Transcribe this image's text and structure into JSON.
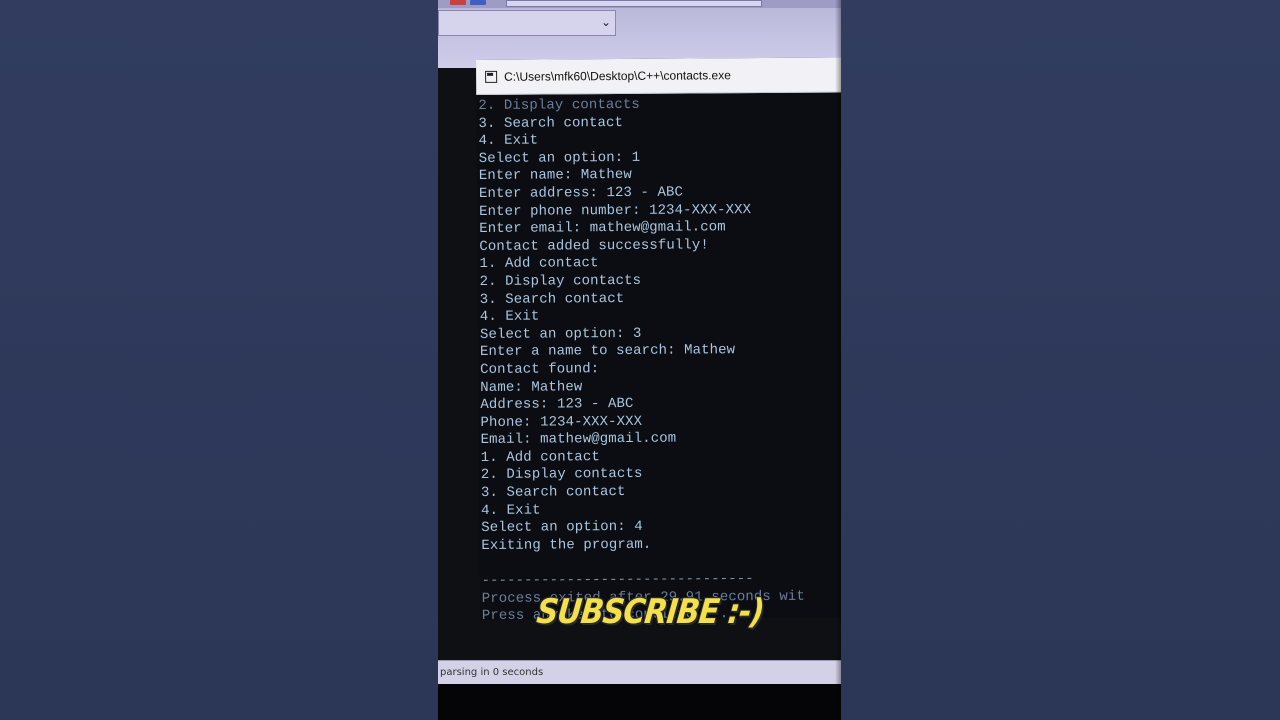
{
  "window": {
    "title": "C:\\Users\\mfk60\\Desktop\\C++\\contacts.exe"
  },
  "console_lines": [
    "2. Display contacts",
    "3. Search contact",
    "4. Exit",
    "Select an option: 1",
    "Enter name: Mathew",
    "Enter address: 123 - ABC",
    "Enter phone number: 1234-XXX-XXX",
    "Enter email: mathew@gmail.com",
    "Contact added successfully!",
    "1. Add contact",
    "2. Display contacts",
    "3. Search contact",
    "4. Exit",
    "Select an option: 3",
    "Enter a name to search: Mathew",
    "Contact found:",
    "Name: Mathew",
    "Address: 123 - ABC",
    "Phone: 1234-XXX-XXX",
    "Email: mathew@gmail.com",
    "1. Add contact",
    "2. Display contacts",
    "3. Search contact",
    "4. Exit",
    "Select an option: 4",
    "Exiting the program.",
    "",
    "--------------------------------",
    "Process exited after 29.91 seconds wit",
    "Press any key to continue . . ."
  ],
  "status_bar": {
    "text": "parsing in 0 seconds"
  },
  "overlay": {
    "caption": "SUBSCRIBE :-)"
  },
  "colors": {
    "console_text": "#a9c6e0",
    "console_bg": "#0c0d12",
    "caption": "#f3e04a",
    "side_bg": "#2f3a5c"
  }
}
